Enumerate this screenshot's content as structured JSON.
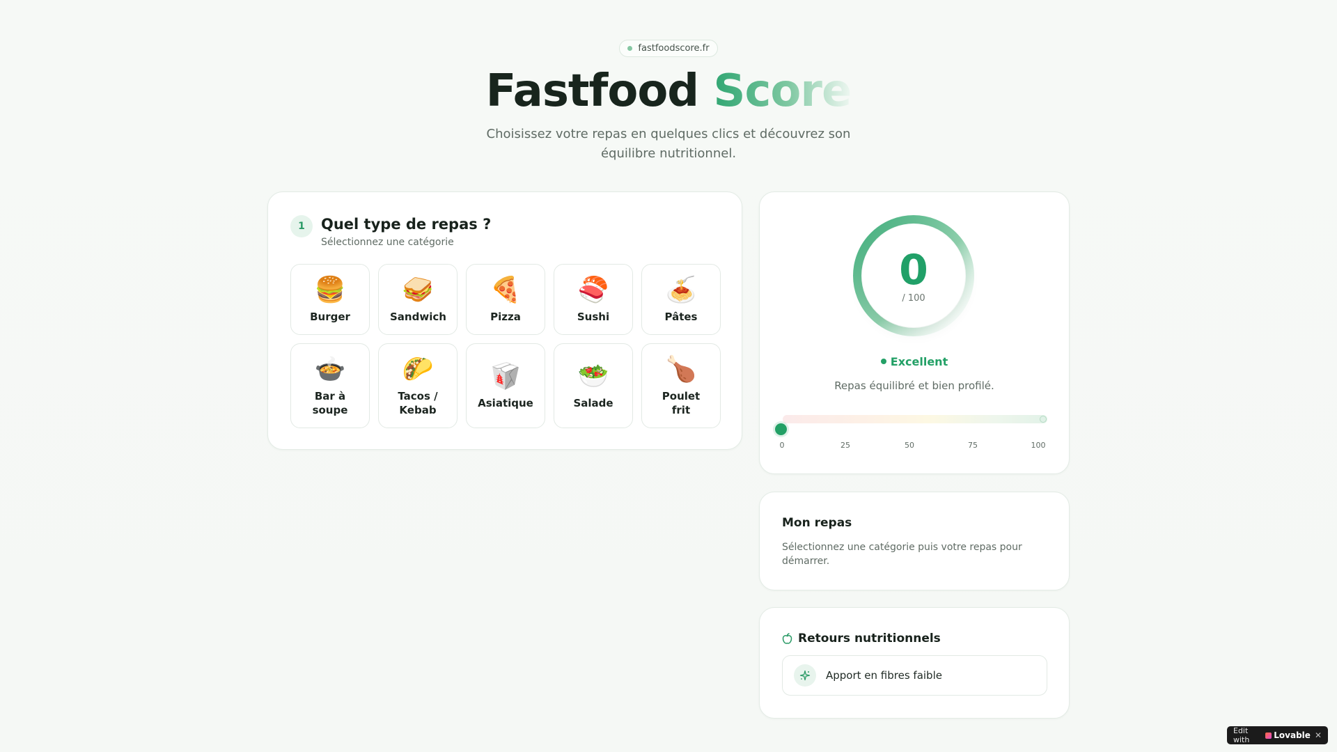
{
  "header": {
    "domain": "fastfoodscore.fr",
    "title_main": "Fastfood ",
    "title_accent": "Score",
    "subtitle": "Choisissez votre repas en quelques clics et découvrez son équilibre nutritionnel."
  },
  "selector": {
    "step": "1",
    "title": "Quel type de repas ?",
    "subtitle": "Sélectionnez une catégorie",
    "categories": [
      {
        "emoji": "🍔",
        "label": "Burger"
      },
      {
        "emoji": "🥪",
        "label": "Sandwich"
      },
      {
        "emoji": "🍕",
        "label": "Pizza"
      },
      {
        "emoji": "🍣",
        "label": "Sushi"
      },
      {
        "emoji": "🍝",
        "label": "Pâtes"
      },
      {
        "emoji": "🍲",
        "label": "Bar à soupe"
      },
      {
        "emoji": "🌮",
        "label": "Tacos / Kebab"
      },
      {
        "emoji": "🥡",
        "label": "Asiatique"
      },
      {
        "emoji": "🥗",
        "label": "Salade"
      },
      {
        "emoji": "🍗",
        "label": "Poulet frit"
      }
    ]
  },
  "score": {
    "value": "0",
    "max": "/ 100",
    "verdict": "Excellent",
    "verdict_desc": "Repas équilibré et bien profilé.",
    "gauge_ticks": [
      "0",
      "25",
      "50",
      "75",
      "100"
    ],
    "accent_color": "#23a066"
  },
  "meal": {
    "title": "Mon repas",
    "desc": "Sélectionnez une catégorie puis votre repas pour démarrer."
  },
  "feedback": {
    "title": "Retours nutritionnels",
    "icon": "apple-icon",
    "items": [
      {
        "icon": "sparkle-icon",
        "text": "Apport en fibres faible"
      }
    ]
  },
  "badge": {
    "prefix": "Edit with",
    "brand": "Lovable",
    "close": "✕"
  }
}
